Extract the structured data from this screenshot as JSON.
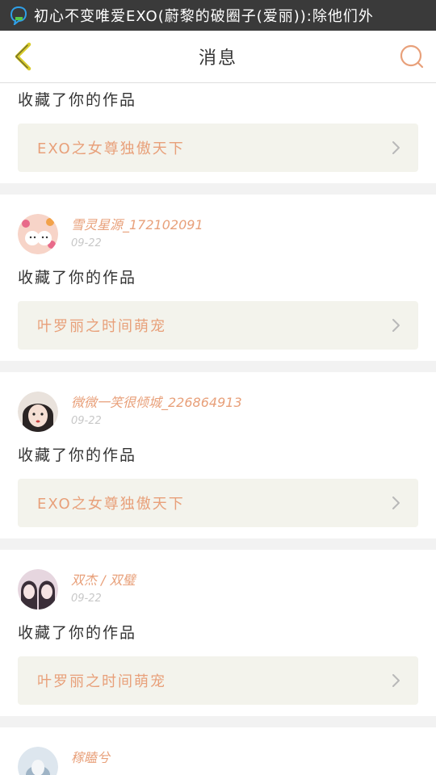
{
  "status_bar": {
    "text": "初心不变唯爱EXO(蔚黎的破圈子(爱丽)):除他们外",
    "icon": "chat-bubble-icon"
  },
  "header": {
    "title": "消息",
    "back_icon": "chevron-left-icon",
    "search_icon": "search-icon",
    "accent": "#e8a07a"
  },
  "notifications": [
    {
      "action": "收藏了你的作品",
      "work_title": "EXO之女尊独傲天下"
    },
    {
      "username": "雪灵星源_172102091",
      "date": "09-22",
      "action": "收藏了你的作品",
      "work_title": "叶罗丽之时间萌宠"
    },
    {
      "username": "微微一笑很倾城_226864913",
      "date": "09-22",
      "action": "收藏了你的作品",
      "work_title": "EXO之女尊独傲天下"
    },
    {
      "username": "双杰 / 双璧",
      "date": "09-22",
      "action": "收藏了你的作品",
      "work_title": "叶罗丽之时间萌宠"
    },
    {
      "username": "稼瞌兮"
    }
  ]
}
